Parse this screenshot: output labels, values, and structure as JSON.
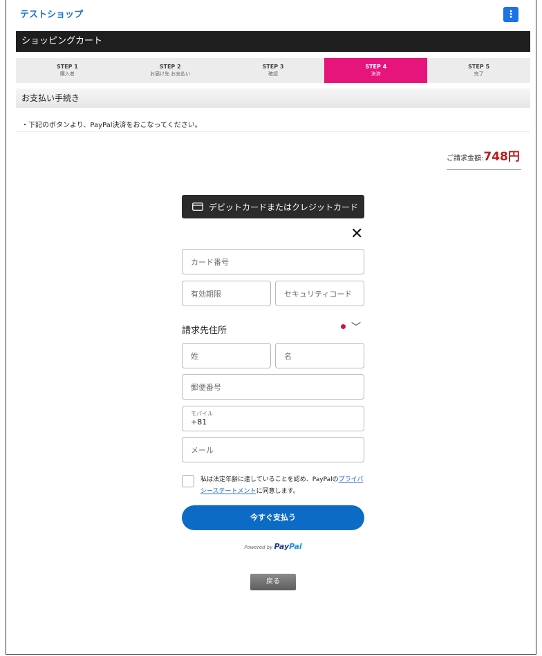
{
  "header": {
    "shop_name": "テストショップ",
    "menu_icon": "⋮"
  },
  "cart_bar": {
    "title": "ショッピングカート"
  },
  "steps": [
    {
      "num": "STEP 1",
      "label": "購入者"
    },
    {
      "num": "STEP 2",
      "label": "お届け先 お支払い"
    },
    {
      "num": "STEP 3",
      "label": "確認"
    },
    {
      "num": "STEP 4",
      "label": "決済",
      "active": true
    },
    {
      "num": "STEP 5",
      "label": "完了"
    }
  ],
  "section": {
    "title": "お支払い手続き"
  },
  "notice": "・下記のボタンより、PayPal決済をおこなってください。",
  "total": {
    "label": "ご請求金額:",
    "amount": "748円"
  },
  "paypal": {
    "card_button": "デビットカードまたはクレジットカード",
    "close": "✕",
    "card_number_placeholder": "カード番号",
    "expiry_placeholder": "有効期限",
    "security_code_placeholder": "セキュリティコード",
    "billing_title": "請求先住所",
    "last_name_placeholder": "姓",
    "first_name_placeholder": "名",
    "postal_placeholder": "郵便番号",
    "mobile_label": "モバイル",
    "mobile_value": "+81",
    "email_placeholder": "メール",
    "consent_prefix": "私は法定年齢に達していることを認め、PayPalの",
    "consent_link": "プライバシーステートメント",
    "consent_suffix": "に同意します。",
    "pay_button": "今すぐ支払う",
    "powered_by": "Powered by",
    "brand_pay": "Pay",
    "brand_pal": "Pal"
  },
  "back_button": "戻る",
  "colors": {
    "accent_step": "#e5157c",
    "pay_button": "#0c6bc5",
    "total_amount": "#b81c1c"
  }
}
